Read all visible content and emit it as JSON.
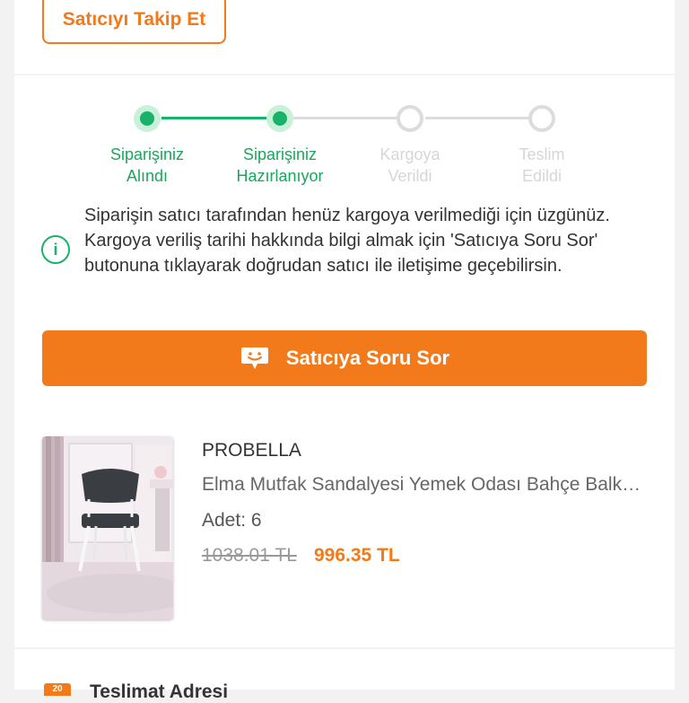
{
  "header": {
    "follow_label": "Satıcıyı Takip Et"
  },
  "stepper": {
    "steps": [
      {
        "label": "Siparişiniz\nAlındı",
        "state": "done"
      },
      {
        "label": "Siparişiniz\nHazırlanıyor",
        "state": "done"
      },
      {
        "label": "Kargoya\nVerildi",
        "state": "pending"
      },
      {
        "label": "Teslim\nEdildi",
        "state": "pending"
      }
    ]
  },
  "notice": {
    "icon": "info-icon",
    "text": "Siparişin satıcı tarafından henüz kargoya verilmediği için üzgünüz. Kargoya veriliş tarihi hakkında bilgi almak için 'Satıcıya Soru Sor' butonuna tıklayarak doğrudan satıcı ile iletişime geçebilirsin."
  },
  "ask_button": {
    "label": "Satıcıya Soru Sor",
    "icon": "chat-bubble-icon"
  },
  "product": {
    "brand": "PROBELLA",
    "name": "Elma Mutfak Sandalyesi Yemek Odası Bahçe Balkon Sandalye",
    "quantity": "Adet: 6",
    "old_price": "1038.01 TL",
    "new_price": "996.35 TL"
  },
  "bottom": {
    "icon_text": "20",
    "label": "Teslimat Adresi"
  },
  "colors": {
    "accent": "#f27a1a",
    "success": "#19b26a",
    "pending": "#dcdcdc"
  }
}
